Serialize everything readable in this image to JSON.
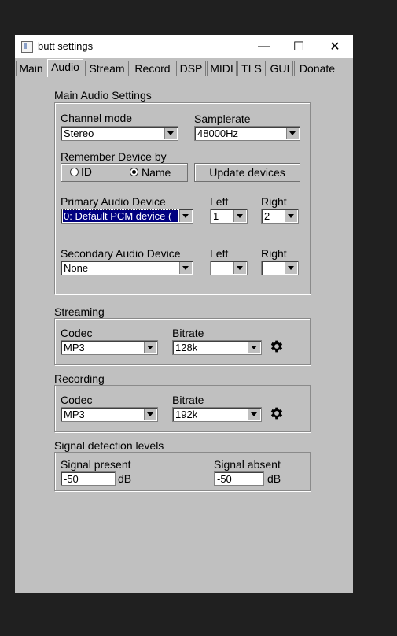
{
  "window": {
    "title": "butt settings",
    "controls": {
      "minimize": "—",
      "maximize": "☐",
      "close": "✕"
    }
  },
  "tabs": [
    {
      "label": "Main"
    },
    {
      "label": "Audio",
      "active": true
    },
    {
      "label": "Stream"
    },
    {
      "label": "Record"
    },
    {
      "label": "DSP"
    },
    {
      "label": "MIDI"
    },
    {
      "label": "TLS"
    },
    {
      "label": "GUI"
    },
    {
      "label": "Donate"
    }
  ],
  "main_audio": {
    "heading": "Main Audio Settings",
    "channel_mode": {
      "label": "Channel mode",
      "value": "Stereo"
    },
    "samplerate": {
      "label": "Samplerate",
      "value": "48000Hz"
    },
    "remember": {
      "label": "Remember Device by",
      "options": [
        {
          "label": "ID",
          "selected": false
        },
        {
          "label": "Name",
          "selected": true
        }
      ]
    },
    "update_button": "Update devices",
    "primary": {
      "label": "Primary Audio Device",
      "value": "0: Default PCM device (",
      "left_label": "Left",
      "left_value": "1",
      "right_label": "Right",
      "right_value": "2"
    },
    "secondary": {
      "label": "Secondary Audio Device",
      "value": "None",
      "left_label": "Left",
      "left_value": "",
      "right_label": "Right",
      "right_value": ""
    }
  },
  "streaming": {
    "heading": "Streaming",
    "codec_label": "Codec",
    "codec": "MP3",
    "bitrate_label": "Bitrate",
    "bitrate": "128k"
  },
  "recording": {
    "heading": "Recording",
    "codec_label": "Codec",
    "codec": "MP3",
    "bitrate_label": "Bitrate",
    "bitrate": "192k"
  },
  "signal": {
    "heading": "Signal detection levels",
    "present_label": "Signal present",
    "present_value": "-50",
    "present_unit": "dB",
    "absent_label": "Signal absent",
    "absent_value": "-50",
    "absent_unit": "dB"
  },
  "icons": {
    "gear": "gear-icon"
  }
}
